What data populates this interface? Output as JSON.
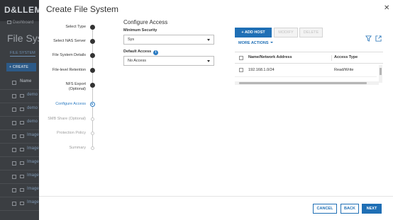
{
  "background": {
    "logo": "D&LLEMC",
    "breadcrumb": "Dashboard",
    "page_title": "File Syst",
    "tab_label": "FILE SYSTEM",
    "create_label": "+ CREATE",
    "table_header": "Name",
    "rows": [
      "demo",
      "demo",
      "demo",
      "Image",
      "Image",
      "Image",
      "Image",
      "Image",
      "Image"
    ]
  },
  "modal": {
    "title": "Create File System",
    "close": "✕"
  },
  "steps": [
    {
      "label": "Select Type",
      "state": "done"
    },
    {
      "label": "Select NAS Server",
      "state": "done"
    },
    {
      "label": "File System Details",
      "state": "done"
    },
    {
      "label": "File-level Retention",
      "state": "done"
    },
    {
      "label": "NFS Export (Optional)",
      "state": "done"
    },
    {
      "label": "Configure Access",
      "state": "current"
    },
    {
      "label": "SMB Share (Optional)",
      "state": "future"
    },
    {
      "label": "Protection Policy",
      "state": "future"
    },
    {
      "label": "Summary",
      "state": "future"
    }
  ],
  "configure": {
    "section_title": "Configure Access",
    "min_security_label": "Minimum Security",
    "min_security_value": "Sys",
    "default_access_label": "Default Access",
    "info_glyph": "i",
    "default_access_value": "No Access"
  },
  "actions": {
    "add_host": "+ ADD HOST",
    "modify": "MODIFY",
    "delete": "DELETE",
    "more_actions": "MORE ACTIONS"
  },
  "hosts_table": {
    "columns": [
      "Name/Network Address",
      "Access Type"
    ],
    "rows": [
      {
        "address": "192.168.1.0/24",
        "access": "Read/Write"
      }
    ]
  },
  "footer": {
    "cancel": "CANCEL",
    "back": "BACK",
    "next": "NEXT"
  },
  "colors": {
    "primary": "#1f6fb5",
    "current_step": "#2b7bc2"
  },
  "icons": {
    "filter": "filter-icon",
    "export": "export-icon",
    "close": "close-icon",
    "info": "info-icon"
  }
}
